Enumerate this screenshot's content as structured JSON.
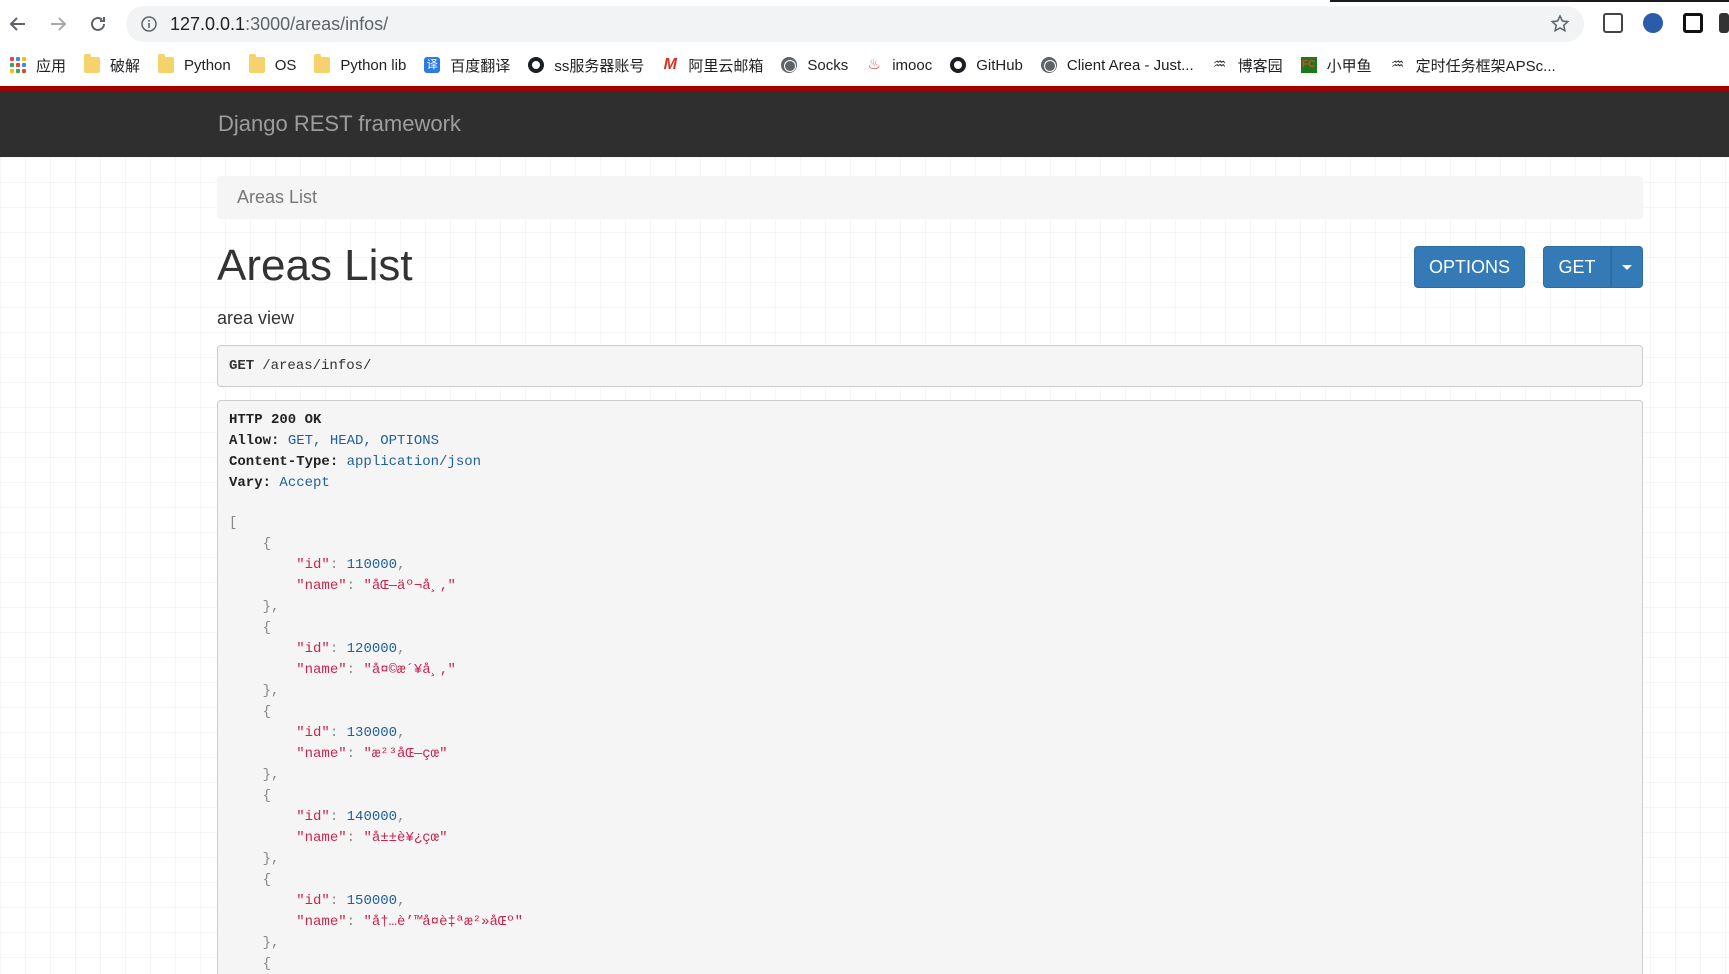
{
  "browser": {
    "url_host": "127.0.0.1",
    "url_rest": ":3000/areas/infos/",
    "bookmarks": [
      {
        "label": "应用",
        "icon": "apps-icon"
      },
      {
        "label": "破解",
        "icon": "folder-icon"
      },
      {
        "label": "Python",
        "icon": "folder-icon"
      },
      {
        "label": "OS",
        "icon": "folder-icon"
      },
      {
        "label": "Python lib",
        "icon": "folder-icon"
      },
      {
        "label": "百度翻译",
        "icon": "translate-icon"
      },
      {
        "label": "ss服务器账号",
        "icon": "github-icon"
      },
      {
        "label": "阿里云邮箱",
        "icon": "mail-icon"
      },
      {
        "label": "Socks",
        "icon": "globe-icon"
      },
      {
        "label": "imooc",
        "icon": "fire-icon"
      },
      {
        "label": "GitHub",
        "icon": "github-icon"
      },
      {
        "label": "Client Area - Just...",
        "icon": "globe-icon"
      },
      {
        "label": "博客园",
        "icon": "cnblogs-icon"
      },
      {
        "label": "小甲鱼",
        "icon": "fc-icon"
      },
      {
        "label": "定时任务框架APSc...",
        "icon": "cnblogs-icon"
      }
    ]
  },
  "navbar": {
    "brand": "Django REST framework"
  },
  "breadcrumb": {
    "current": "Areas List"
  },
  "page": {
    "title": "Areas List",
    "description": "area view",
    "options_label": "OPTIONS",
    "get_label": "GET"
  },
  "request": {
    "method": "GET",
    "path": "/areas/infos/"
  },
  "response": {
    "status": "HTTP 200 OK",
    "headers": [
      {
        "name": "Allow:",
        "value": "GET, HEAD, OPTIONS"
      },
      {
        "name": "Content-Type:",
        "value": "application/json"
      },
      {
        "name": "Vary:",
        "value": "Accept"
      }
    ],
    "items": [
      {
        "id": "110000",
        "name": "\"åŒ—äº¬å¸‚\""
      },
      {
        "id": "120000",
        "name": "\"å¤©æ´¥å¸‚\""
      },
      {
        "id": "130000",
        "name": "\"æ²³åŒ—çœ\""
      },
      {
        "id": "140000",
        "name": "\"å±±è¥¿çœ\""
      },
      {
        "id": "150000",
        "name": "\"å†…è’™å¤è‡ªæ²»åŒº\""
      }
    ]
  },
  "colors": {
    "navbar": "#2f2f2f",
    "accent_red": "#a30000",
    "button": "#337ab7"
  }
}
